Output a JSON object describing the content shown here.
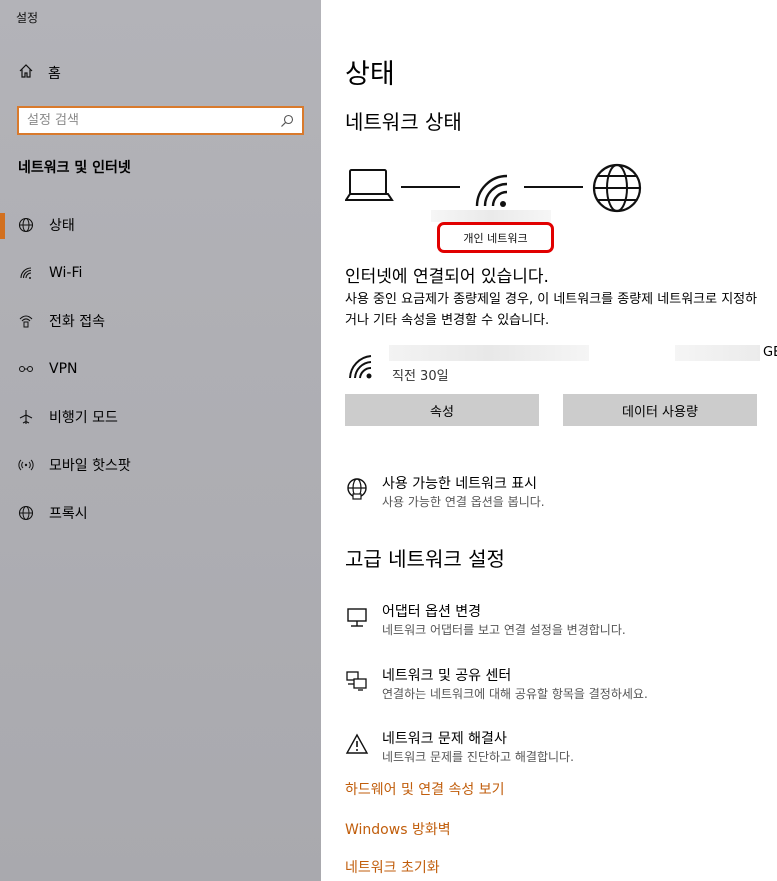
{
  "window": {
    "title": "설정"
  },
  "sidebar": {
    "home_label": "홈",
    "search_placeholder": "설정 검색",
    "section_title": "네트워크 및 인터넷",
    "items": [
      {
        "label": "상태",
        "icon": "globe-icon"
      },
      {
        "label": "Wi-Fi",
        "icon": "wifi-icon"
      },
      {
        "label": "전화 접속",
        "icon": "dialup-icon"
      },
      {
        "label": "VPN",
        "icon": "vpn-icon"
      },
      {
        "label": "비행기 모드",
        "icon": "airplane-icon"
      },
      {
        "label": "모바일 핫스팟",
        "icon": "hotspot-icon"
      },
      {
        "label": "프록시",
        "icon": "globe-icon"
      }
    ]
  },
  "main": {
    "page_title": "상태",
    "network_status_title": "네트워크 상태",
    "network_type_label": "개인 네트워크",
    "connected_text": "인터넷에 연결되어 있습니다.",
    "description": "사용 중인 요금제가 종량제일 경우, 이 네트워크를 종량제 네트워크로 지정하거나 기타 속성을 변경할 수 있습니다.",
    "usage_unit": "GB",
    "usage_period": "직전 30일",
    "properties_button": "속성",
    "data_usage_button": "데이터 사용량",
    "show_networks": {
      "title": "사용 가능한 네트워크 표시",
      "subtitle": "사용 가능한 연결 옵션을 봅니다."
    },
    "advanced_title": "고급 네트워크 설정",
    "adapter": {
      "title": "어댑터 옵션 변경",
      "subtitle": "네트워크 어댑터를 보고 연결 설정을 변경합니다."
    },
    "sharing_center": {
      "title": "네트워크 및 공유 센터",
      "subtitle": "연결하는 네트워크에 대해 공유할 항목을 결정하세요."
    },
    "troubleshooter": {
      "title": "네트워크 문제 해결사",
      "subtitle": "네트워크 문제를 진단하고 해결합니다."
    },
    "links": {
      "hardware": "하드웨어 및 연결 속성 보기",
      "firewall": "Windows 방화벽",
      "reset": "네트워크 초기화"
    }
  },
  "colors": {
    "accent": "#d2701f",
    "link": "#c15e0c",
    "highlight": "#e10000",
    "sidebar_bg": "#afafb4"
  }
}
